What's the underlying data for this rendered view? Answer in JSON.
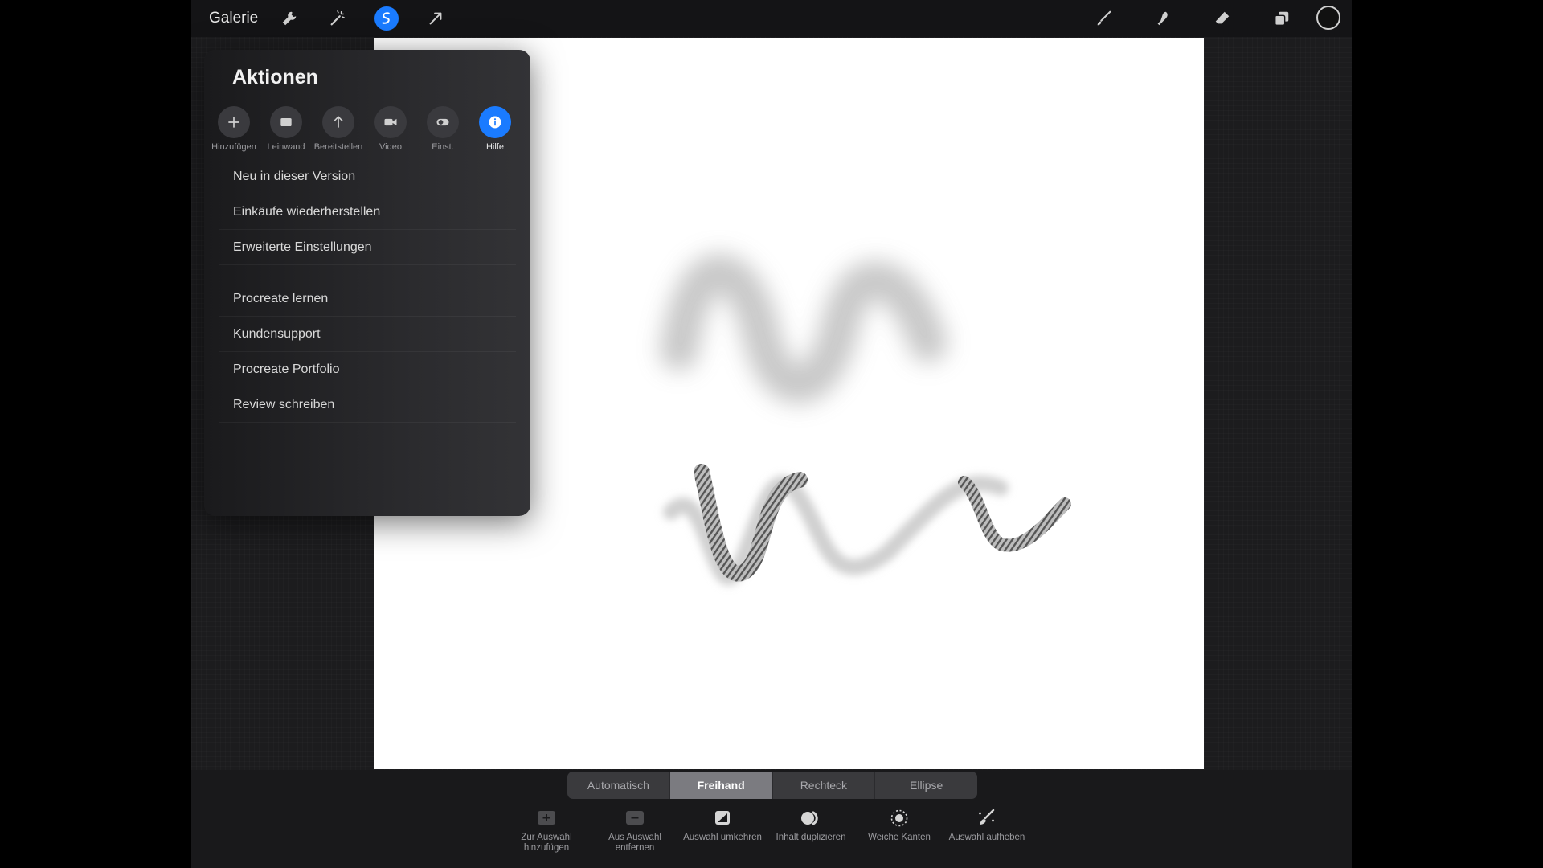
{
  "topbar": {
    "gallery_label": "Galerie",
    "icons": [
      "wrench-icon",
      "magic-wand-icon",
      "selection-icon",
      "transform-arrow-icon",
      "brush-icon",
      "smudge-icon",
      "eraser-icon",
      "layers-icon",
      "color-icon"
    ],
    "accent": "#1a7bff"
  },
  "actions": {
    "title": "Aktionen",
    "tabs": [
      {
        "label": "Hinzufügen",
        "icon": "plus-icon"
      },
      {
        "label": "Leinwand",
        "icon": "canvas-icon"
      },
      {
        "label": "Bereitstellen",
        "icon": "share-arrow-icon"
      },
      {
        "label": "Video",
        "icon": "video-icon"
      },
      {
        "label": "Einst.",
        "icon": "toggle-icon"
      },
      {
        "label": "Hilfe",
        "icon": "info-icon",
        "active": true
      }
    ],
    "menu": [
      "Neu in dieser Version",
      "Einkäufe wiederherstellen",
      "Erweiterte Einstellungen",
      "Procreate lernen",
      "Kundensupport",
      "Procreate Portfolio",
      "Review schreiben"
    ]
  },
  "selection": {
    "modes": [
      "Automatisch",
      "Freihand",
      "Rechteck",
      "Ellipse"
    ],
    "active_mode": "Freihand",
    "tools": [
      {
        "line1": "Zur Auswahl",
        "line2": "hinzufügen",
        "icon": "add-selection-icon"
      },
      {
        "line1": "Aus Auswahl",
        "line2": "entfernen",
        "icon": "remove-selection-icon"
      },
      {
        "line1": "Auswahl umkehren",
        "line2": "",
        "icon": "invert-selection-icon"
      },
      {
        "line1": "Inhalt duplizieren",
        "line2": "",
        "icon": "duplicate-icon"
      },
      {
        "line1": "Weiche Kanten",
        "line2": "",
        "icon": "feather-icon"
      },
      {
        "line1": "Auswahl aufheben",
        "line2": "",
        "icon": "clear-selection-icon"
      }
    ]
  }
}
